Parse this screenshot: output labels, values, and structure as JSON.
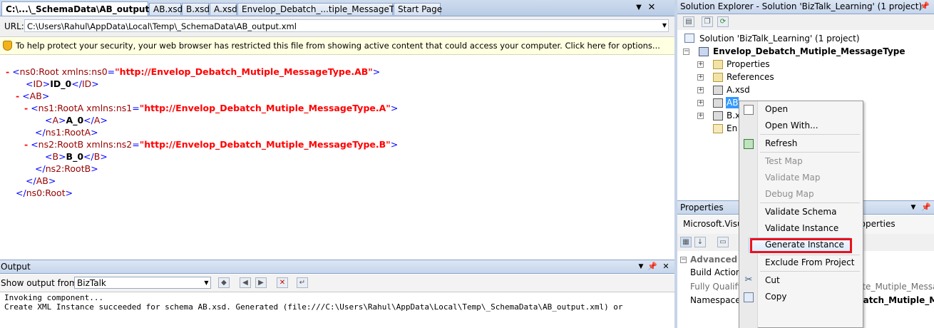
{
  "tabs": [
    {
      "label": "C:\\...\\_SchemaData\\AB_output.xml"
    },
    {
      "label": "AB.xsd"
    },
    {
      "label": "B.xsd"
    },
    {
      "label": "A.xsd"
    },
    {
      "label": "Envelop_Debatch_...tiple_MessageType"
    },
    {
      "label": "Start Page"
    }
  ],
  "url_bar": {
    "label": "URL:",
    "value": "C:\\Users\\Rahul\\AppData\\Local\\Temp\\_SchemaData\\AB_output.xml"
  },
  "info_bar": {
    "text": "To help protect your security, your web browser has restricted this file from showing active content that could access your computer. Click here for options..."
  },
  "xml": {
    "ns0_uri": "\"http://Envelop_Debatch_Mutiple_MessageType.AB\"",
    "ns1_uri": "\"http://Envelop_Debatch_Mutiple_MessageType.A\"",
    "ns2_uri": "\"http://Envelop_Debatch_Mutiple_MessageType.B\"",
    "id_value": "ID_0",
    "a_value": "A_0",
    "b_value": "B_0"
  },
  "output": {
    "title": "Output",
    "show_from_label": "Show output from:",
    "source": "BizTalk",
    "lines": [
      "Invoking component...",
      "Create XML Instance succeeded for schema AB.xsd. Generated (file:///C:\\Users\\Rahul\\AppData\\Local\\Temp\\_SchemaData\\AB_output.xml) or"
    ]
  },
  "solution_explorer": {
    "title": "Solution Explorer - Solution 'BizTalk_Learning' (1 project)",
    "solution": "Solution 'BizTalk_Learning' (1 project)",
    "project": "Envelop_Debatch_Mutiple_MessageType",
    "items": [
      "Properties",
      "References",
      "A.xsd",
      "AB",
      "B.x",
      "En"
    ]
  },
  "properties": {
    "title": "Properties",
    "object": "Microsoft.Visu",
    "object_suffix": "roperties",
    "category": "Advanced",
    "rows": [
      {
        "name": "Build Action",
        "value": ""
      },
      {
        "name": "Fully Qualifi",
        "value": "Envelop_Debatch_Mutiple_Messa"
      },
      {
        "name": "Namespace",
        "value": "Envelop_Debatch_Mutiple_Mes"
      }
    ]
  },
  "context_menu": {
    "items": [
      {
        "label": "Open",
        "enabled": true
      },
      {
        "label": "Open With...",
        "enabled": true
      },
      {
        "label": "Refresh",
        "enabled": true
      },
      {
        "label": "Test Map",
        "enabled": false
      },
      {
        "label": "Validate Map",
        "enabled": false
      },
      {
        "label": "Debug Map",
        "enabled": false
      },
      {
        "label": "Validate Schema",
        "enabled": true
      },
      {
        "label": "Validate Instance",
        "enabled": true
      },
      {
        "label": "Generate Instance",
        "enabled": true
      },
      {
        "label": "Exclude From Project",
        "enabled": true
      },
      {
        "label": "Cut",
        "enabled": true
      },
      {
        "label": "Copy",
        "enabled": true
      }
    ]
  },
  "colors": {
    "highlight_box": "#e8121c",
    "xml_markup": "#ff0000",
    "xml_tag": "#990000",
    "xml_bracket": "#0000ff"
  }
}
